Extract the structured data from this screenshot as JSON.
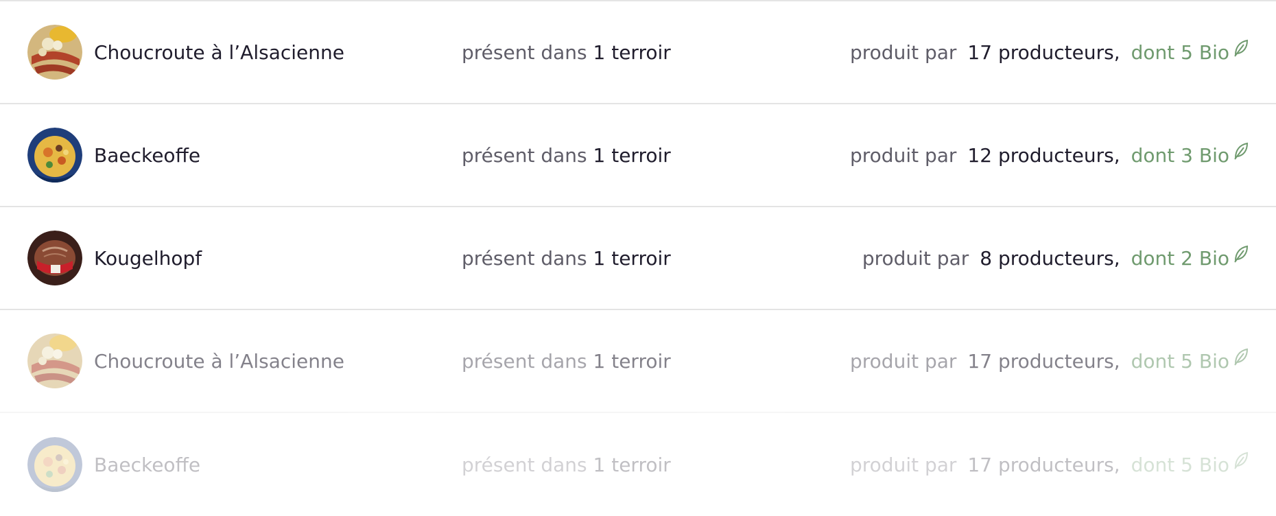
{
  "colors": {
    "text_dark": "#1f1c2c",
    "text_muted": "#5f5d68",
    "bio_green": "#6f9a6e",
    "divider": "#e4e4e4"
  },
  "rows": [
    {
      "name": "Choucroute à l’Alsacienne",
      "presence_prefix": "présent dans",
      "presence_value": "1 terroir",
      "producers_prefix": "produit par",
      "producers_value": "17 producteurs,",
      "bio_text": "dont 5 Bio",
      "avatar_icon": "choucroute-photo"
    },
    {
      "name": "Baeckeoffe",
      "presence_prefix": "présent dans",
      "presence_value": "1 terroir",
      "producers_prefix": "produit par",
      "producers_value": "12 producteurs,",
      "bio_text": "dont 3 Bio",
      "avatar_icon": "baeckeoffe-photo"
    },
    {
      "name": "Kougelhopf",
      "presence_prefix": "présent dans",
      "presence_value": "1 terroir",
      "producers_prefix": "produit par",
      "producers_value": "8 producteurs,",
      "bio_text": "dont 2 Bio",
      "avatar_icon": "kougelhopf-photo"
    },
    {
      "name": "Choucroute à l’Alsacienne",
      "presence_prefix": "présent dans",
      "presence_value": "1 terroir",
      "producers_prefix": "produit par",
      "producers_value": "17 producteurs,",
      "bio_text": "dont 5 Bio",
      "avatar_icon": "choucroute-photo"
    },
    {
      "name": "Baeckeoffe",
      "presence_prefix": "présent dans",
      "presence_value": "1 terroir",
      "producers_prefix": "produit par",
      "producers_value": "17 producteurs,",
      "bio_text": "dont 5 Bio",
      "avatar_icon": "baeckeoffe-photo"
    }
  ]
}
